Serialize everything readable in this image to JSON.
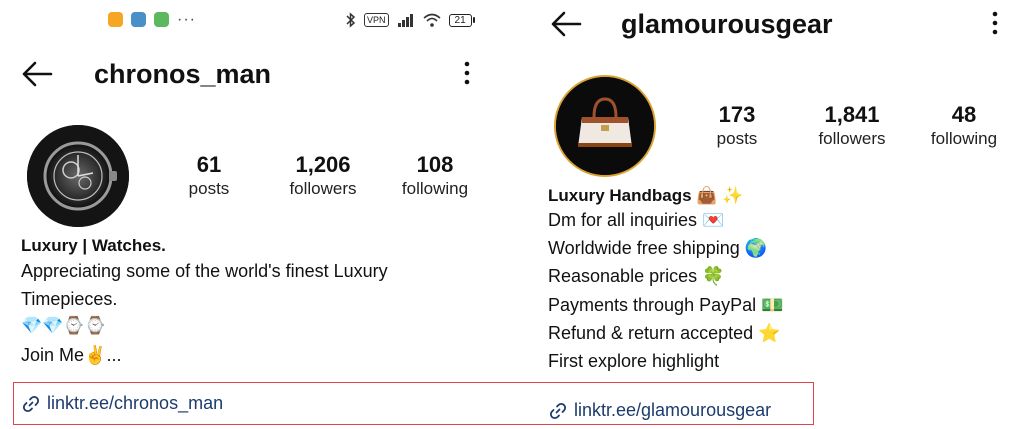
{
  "left_profile": {
    "status_bar": {
      "app_icons": [
        {
          "icon": "notes-app-icon",
          "color": "#f5a623"
        },
        {
          "icon": "telegram-app-icon",
          "color": "#4a90c8"
        },
        {
          "icon": "wechat-app-icon",
          "color": "#5cb85c"
        }
      ],
      "more": "···",
      "vpn": "VPN",
      "battery": "21"
    },
    "username": "chronos_man",
    "stats": [
      {
        "value": "61",
        "label": "posts"
      },
      {
        "value": "1,206",
        "label": "followers"
      },
      {
        "value": "108",
        "label": "following"
      }
    ],
    "bio": {
      "name": "Luxury | Watches.",
      "lines": [
        "Appreciating some of the world's finest Luxury",
        "Timepieces.",
        "💎💎⌚⌚",
        "Join Me✌️..."
      ]
    },
    "link": "linktr.ee/chronos_man"
  },
  "right_profile": {
    "username": "glamourousgear",
    "stats": [
      {
        "value": "173",
        "label": "posts"
      },
      {
        "value": "1,841",
        "label": "followers"
      },
      {
        "value": "48",
        "label": "following"
      }
    ],
    "bio": {
      "name": "Luxury Handbags 👜 ✨",
      "lines": [
        "Dm for all inquiries 💌",
        "Worldwide free shipping 🌍",
        "Reasonable prices 🍀",
        "Payments through PayPal 💵",
        "Refund & return accepted ⭐",
        "First explore highlight"
      ]
    },
    "link": "linktr.ee/glamourousgear"
  },
  "colors": {
    "link": "#1c3b6e",
    "highlight_border": "#e0434a",
    "avatar_ring": "#d9a233"
  }
}
